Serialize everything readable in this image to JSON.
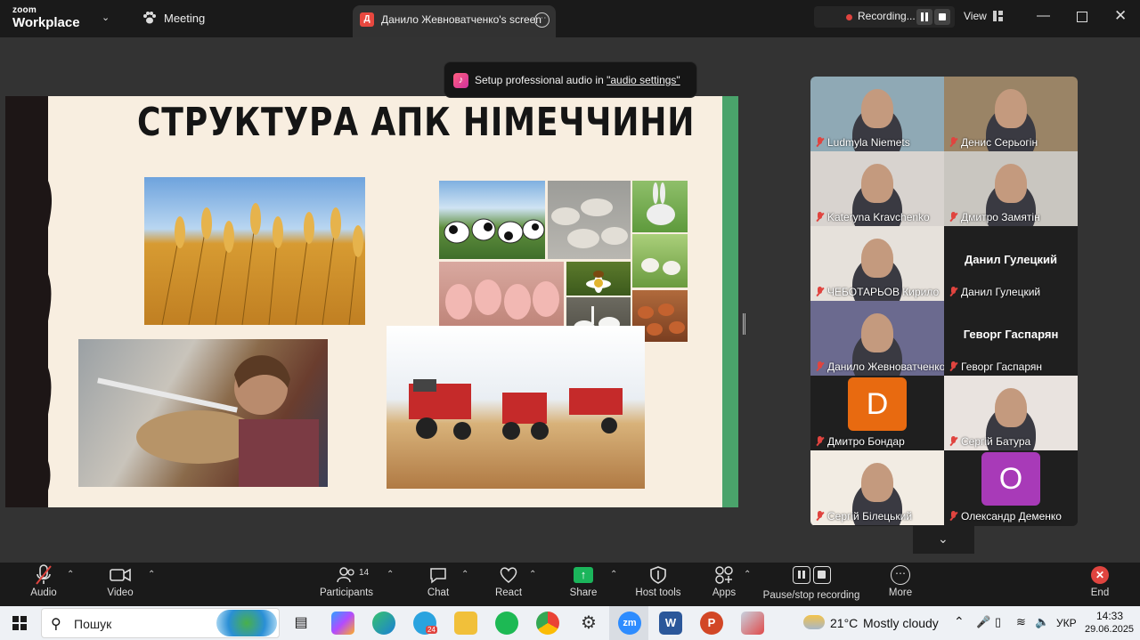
{
  "app": {
    "brand_top": "zoom",
    "brand_bottom": "Workplace"
  },
  "tabs": {
    "meeting": "Meeting",
    "screen": "Данило Жевноватченко's screen",
    "screen_avatar": "Д"
  },
  "recording": {
    "label": "Recording...",
    "view": "View"
  },
  "toast": {
    "text": "Setup professional audio in ",
    "link": "\"audio settings\""
  },
  "slide": {
    "title": "СТРУКТУРА АПК НІМЕЧЧИНИ"
  },
  "participants": [
    {
      "name": "Ludmyla Niemets",
      "kind": "video",
      "bg": "#8fa9b5"
    },
    {
      "name": "Денис Серьогін",
      "kind": "video",
      "bg": "#9a8466"
    },
    {
      "name": "Kateryna Kravchenko",
      "kind": "video",
      "bg": "#d8d3cf"
    },
    {
      "name": "Дмитро Замятін",
      "kind": "video",
      "bg": "#c9c6c0"
    },
    {
      "name": "ЧЕБОТАРЬОВ Кирило",
      "kind": "video",
      "bg": "#e6e1db"
    },
    {
      "name": "Данил Гулецкий",
      "kind": "text",
      "display": "Данил Гулецкий"
    },
    {
      "name": "Данило Жевноватченко",
      "kind": "video",
      "bg": "#6b6a8f",
      "active": true
    },
    {
      "name": "Геворг Гаспарян",
      "kind": "text",
      "display": "Геворг Гаспарян"
    },
    {
      "name": "Дмитро Бондар",
      "kind": "letter",
      "letter": "D",
      "bg": "#e86a10"
    },
    {
      "name": "Сергій Батура",
      "kind": "video",
      "bg": "#e9e3df"
    },
    {
      "name": "Сергій Білецький",
      "kind": "video",
      "bg": "#f2ece3"
    },
    {
      "name": "Олександр Деменко",
      "kind": "letter",
      "letter": "O",
      "bg": "#a83ab8"
    }
  ],
  "toolbar": {
    "audio": "Audio",
    "video": "Video",
    "participants": "Participants",
    "participants_count": "14",
    "chat": "Chat",
    "react": "React",
    "share": "Share",
    "host_tools": "Host tools",
    "apps": "Apps",
    "pause_rec": "Pause/stop recording",
    "more": "More",
    "end": "End"
  },
  "taskbar": {
    "search": "Пошук",
    "weather_temp": "21°C",
    "weather_text": "Mostly cloudy",
    "lang": "УКР",
    "time": "14:33",
    "date": "29.06.2025",
    "telegram_badge": "24"
  },
  "colors": {
    "accent_green": "#22c55e",
    "record_red": "#e0443f",
    "share_green": "#1bb55b"
  }
}
